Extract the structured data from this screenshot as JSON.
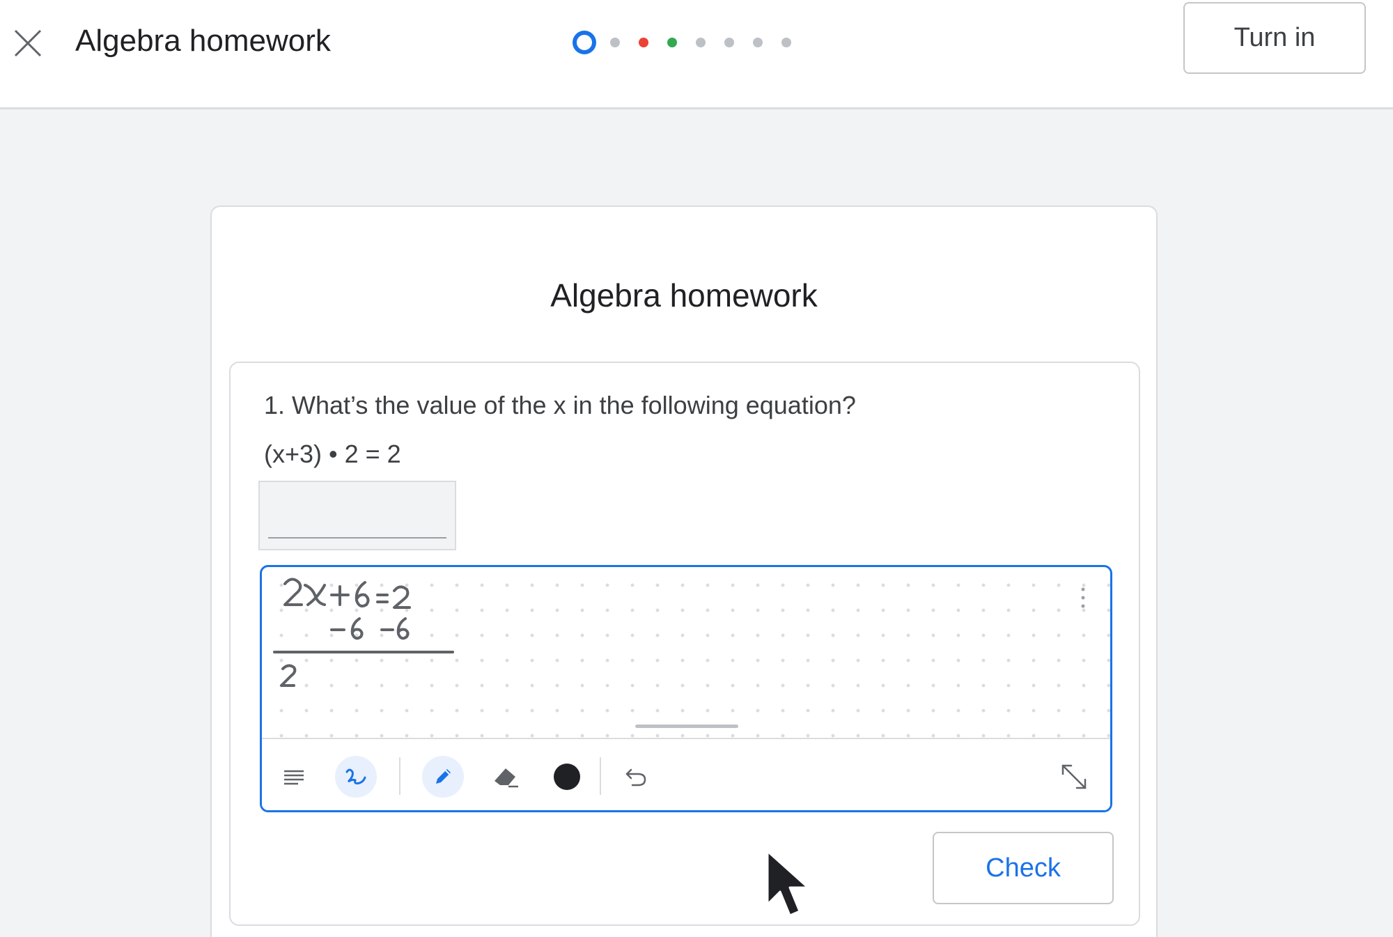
{
  "header": {
    "title": "Algebra homework",
    "close_icon": "close-icon",
    "turn_in_label": "Turn in",
    "progress": [
      {
        "state": "current",
        "color": "#1a73e8"
      },
      {
        "state": "unanswered",
        "color": "#bdc1c6"
      },
      {
        "state": "incorrect",
        "color": "#ea4335"
      },
      {
        "state": "correct",
        "color": "#34a853"
      },
      {
        "state": "unanswered",
        "color": "#bdc1c6"
      },
      {
        "state": "unanswered",
        "color": "#bdc1c6"
      },
      {
        "state": "unanswered",
        "color": "#bdc1c6"
      },
      {
        "state": "unanswered",
        "color": "#bdc1c6"
      }
    ]
  },
  "card": {
    "title": "Algebra homework"
  },
  "question": {
    "text": "1. What’s the value of the x in the following equation?",
    "equation": "(x+3) • 2 = 2",
    "answer_value": "",
    "check_label": "Check"
  },
  "scratch_pad": {
    "handwriting_lines": [
      "2x+6 = 2",
      "−6  −6",
      "2"
    ],
    "tools": [
      {
        "name": "text-mode-icon",
        "active": false
      },
      {
        "name": "handwriting-mode-icon",
        "active": true
      },
      {
        "name": "pen-icon",
        "active": true
      },
      {
        "name": "eraser-icon",
        "active": false
      },
      {
        "name": "ink-color-icon",
        "active": false,
        "color": "#202124"
      },
      {
        "name": "undo-icon",
        "active": false
      },
      {
        "name": "expand-icon",
        "active": false
      }
    ]
  },
  "colors": {
    "accent": "#1a73e8",
    "incorrect": "#ea4335",
    "correct": "#34a853",
    "background": "#f1f3f4"
  }
}
